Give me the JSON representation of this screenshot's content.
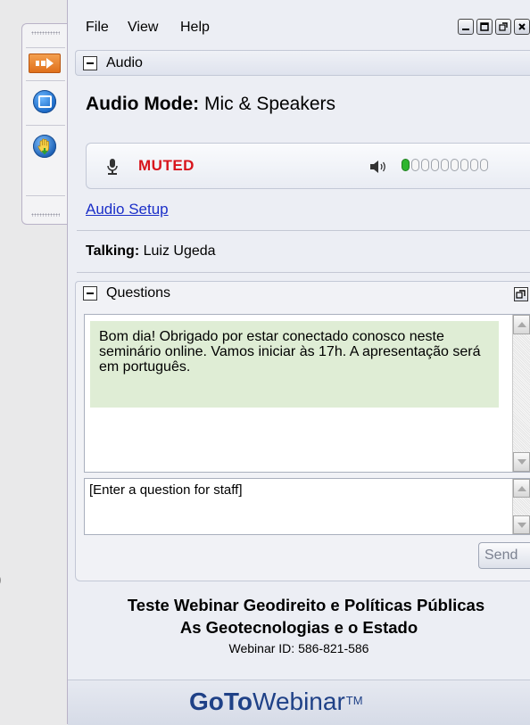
{
  "menu": {
    "items": [
      "File",
      "View",
      "Help"
    ]
  },
  "audio": {
    "section_title": "Audio",
    "mode_label": "Audio Mode:",
    "mode_value": "Mic & Speakers",
    "mic_status": "MUTED",
    "speaker_level_dots": 9,
    "speaker_level_active": 1,
    "setup_link": "Audio Setup",
    "talking_label": "Talking:",
    "talking_value": "Luiz Ugeda"
  },
  "questions": {
    "section_title": "Questions",
    "message": "Bom dia! Obrigado por estar conectado conosco neste seminário online. Vamos iniciar às 17h. A apresentação será em português.",
    "input_placeholder": "[Enter a question for staff]",
    "send_label": "Send"
  },
  "webinar": {
    "title": "Teste Webinar Geodireito e Políticas Públicas",
    "subtitle": "As Geotecnologias e o Estado",
    "id_line": "Webinar ID: 586-821-586"
  },
  "brand": {
    "goto": "GoTo",
    "webinar": "Webinar",
    "tm": "TM"
  },
  "colors": {
    "muted": "#d8141c",
    "link": "#1b2fc8",
    "brand": "#1f4187",
    "message_bg": "#dfedd5",
    "level_active": "#2eb52e"
  },
  "icons": {
    "toolbar": [
      "arrow-right-icon",
      "screen-share-icon",
      "raise-hand-icon"
    ],
    "mic": "microphone-icon",
    "speaker": "speaker-icon"
  }
}
